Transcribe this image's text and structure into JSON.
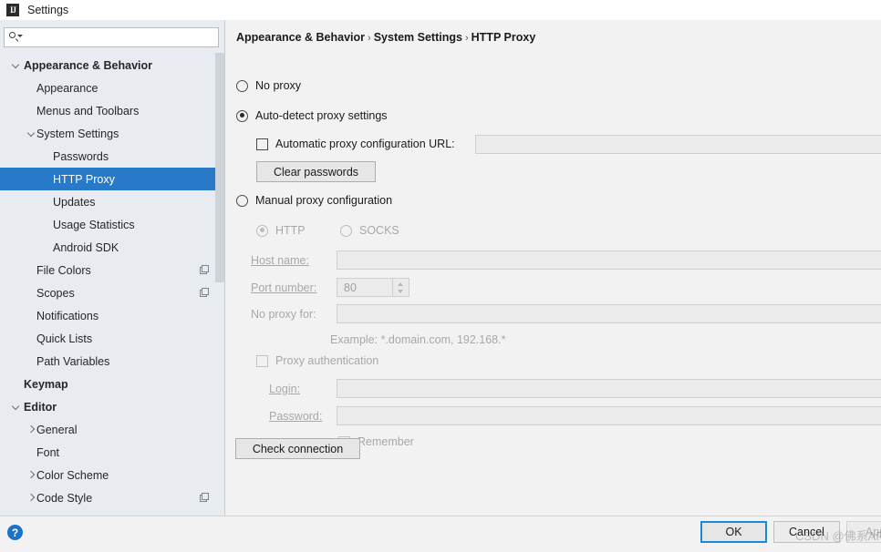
{
  "window": {
    "title": "Settings",
    "app_icon": "intellij-idea-icon",
    "icon_text": "IJ"
  },
  "search": {
    "value": "",
    "placeholder": "",
    "icon": "search-icon"
  },
  "sidebar": {
    "items": [
      {
        "label": "Appearance & Behavior",
        "indent": 0,
        "arrow": "down",
        "bold": true,
        "selected": false,
        "copy_icon": false
      },
      {
        "label": "Appearance",
        "indent": 1,
        "arrow": "none",
        "bold": false,
        "selected": false,
        "copy_icon": false
      },
      {
        "label": "Menus and Toolbars",
        "indent": 1,
        "arrow": "none",
        "bold": false,
        "selected": false,
        "copy_icon": false
      },
      {
        "label": "System Settings",
        "indent": 1,
        "arrow": "down",
        "bold": false,
        "selected": false,
        "copy_icon": false
      },
      {
        "label": "Passwords",
        "indent": 2,
        "arrow": "none",
        "bold": false,
        "selected": false,
        "copy_icon": false
      },
      {
        "label": "HTTP Proxy",
        "indent": 2,
        "arrow": "none",
        "bold": false,
        "selected": true,
        "copy_icon": false
      },
      {
        "label": "Updates",
        "indent": 2,
        "arrow": "none",
        "bold": false,
        "selected": false,
        "copy_icon": false
      },
      {
        "label": "Usage Statistics",
        "indent": 2,
        "arrow": "none",
        "bold": false,
        "selected": false,
        "copy_icon": false
      },
      {
        "label": "Android SDK",
        "indent": 2,
        "arrow": "none",
        "bold": false,
        "selected": false,
        "copy_icon": false
      },
      {
        "label": "File Colors",
        "indent": 1,
        "arrow": "none",
        "bold": false,
        "selected": false,
        "copy_icon": true
      },
      {
        "label": "Scopes",
        "indent": 1,
        "arrow": "none",
        "bold": false,
        "selected": false,
        "copy_icon": true
      },
      {
        "label": "Notifications",
        "indent": 1,
        "arrow": "none",
        "bold": false,
        "selected": false,
        "copy_icon": false
      },
      {
        "label": "Quick Lists",
        "indent": 1,
        "arrow": "none",
        "bold": false,
        "selected": false,
        "copy_icon": false
      },
      {
        "label": "Path Variables",
        "indent": 1,
        "arrow": "none",
        "bold": false,
        "selected": false,
        "copy_icon": false
      },
      {
        "label": "Keymap",
        "indent": 0,
        "arrow": "none",
        "bold": true,
        "selected": false,
        "copy_icon": false
      },
      {
        "label": "Editor",
        "indent": 0,
        "arrow": "down",
        "bold": true,
        "selected": false,
        "copy_icon": false
      },
      {
        "label": "General",
        "indent": 1,
        "arrow": "right",
        "bold": false,
        "selected": false,
        "copy_icon": false
      },
      {
        "label": "Font",
        "indent": 1,
        "arrow": "none",
        "bold": false,
        "selected": false,
        "copy_icon": false
      },
      {
        "label": "Color Scheme",
        "indent": 1,
        "arrow": "right",
        "bold": false,
        "selected": false,
        "copy_icon": false
      },
      {
        "label": "Code Style",
        "indent": 1,
        "arrow": "right",
        "bold": false,
        "selected": false,
        "copy_icon": true
      }
    ]
  },
  "breadcrumb": {
    "part1": "Appearance & Behavior",
    "sep1": "›",
    "part2": "System Settings",
    "sep2": "›",
    "part3": "HTTP Proxy"
  },
  "proxy": {
    "no_proxy_label": "No proxy",
    "no_proxy_checked": false,
    "auto_detect_label": "Auto-detect proxy settings",
    "auto_detect_checked": true,
    "auto_url_label": "Automatic proxy configuration URL:",
    "auto_url_checked": false,
    "auto_url_value": "",
    "clear_passwords_label": "Clear passwords",
    "manual_label": "Manual proxy configuration",
    "manual_checked": false,
    "http_label": "HTTP",
    "http_checked": true,
    "socks_label": "SOCKS",
    "socks_checked": false,
    "host_label": "Host name:",
    "host_value": "",
    "port_label": "Port number:",
    "port_value": "80",
    "no_proxy_for_label": "No proxy for:",
    "no_proxy_for_value": "",
    "example_text": "Example: *.domain.com, 192.168.*",
    "proxy_auth_label": "Proxy authentication",
    "proxy_auth_checked": false,
    "login_label": "Login:",
    "login_value": "",
    "password_label": "Password:",
    "password_value": "",
    "remember_label": "Remember",
    "remember_checked": false,
    "check_connection_label": "Check connection"
  },
  "footer": {
    "help_icon": "help-icon",
    "help_glyph": "?",
    "ok_label": "OK",
    "cancel_label": "Cancel",
    "apply_label": "Apply"
  },
  "watermark": {
    "text": "CSDN @佛系API"
  },
  "colors": {
    "selection": "#2879c8",
    "sidebar_bg": "#e8ecf0",
    "content_bg": "#f2f2f2",
    "accent_button_border": "#1a8ad6",
    "help_blue": "#1a73c8"
  }
}
